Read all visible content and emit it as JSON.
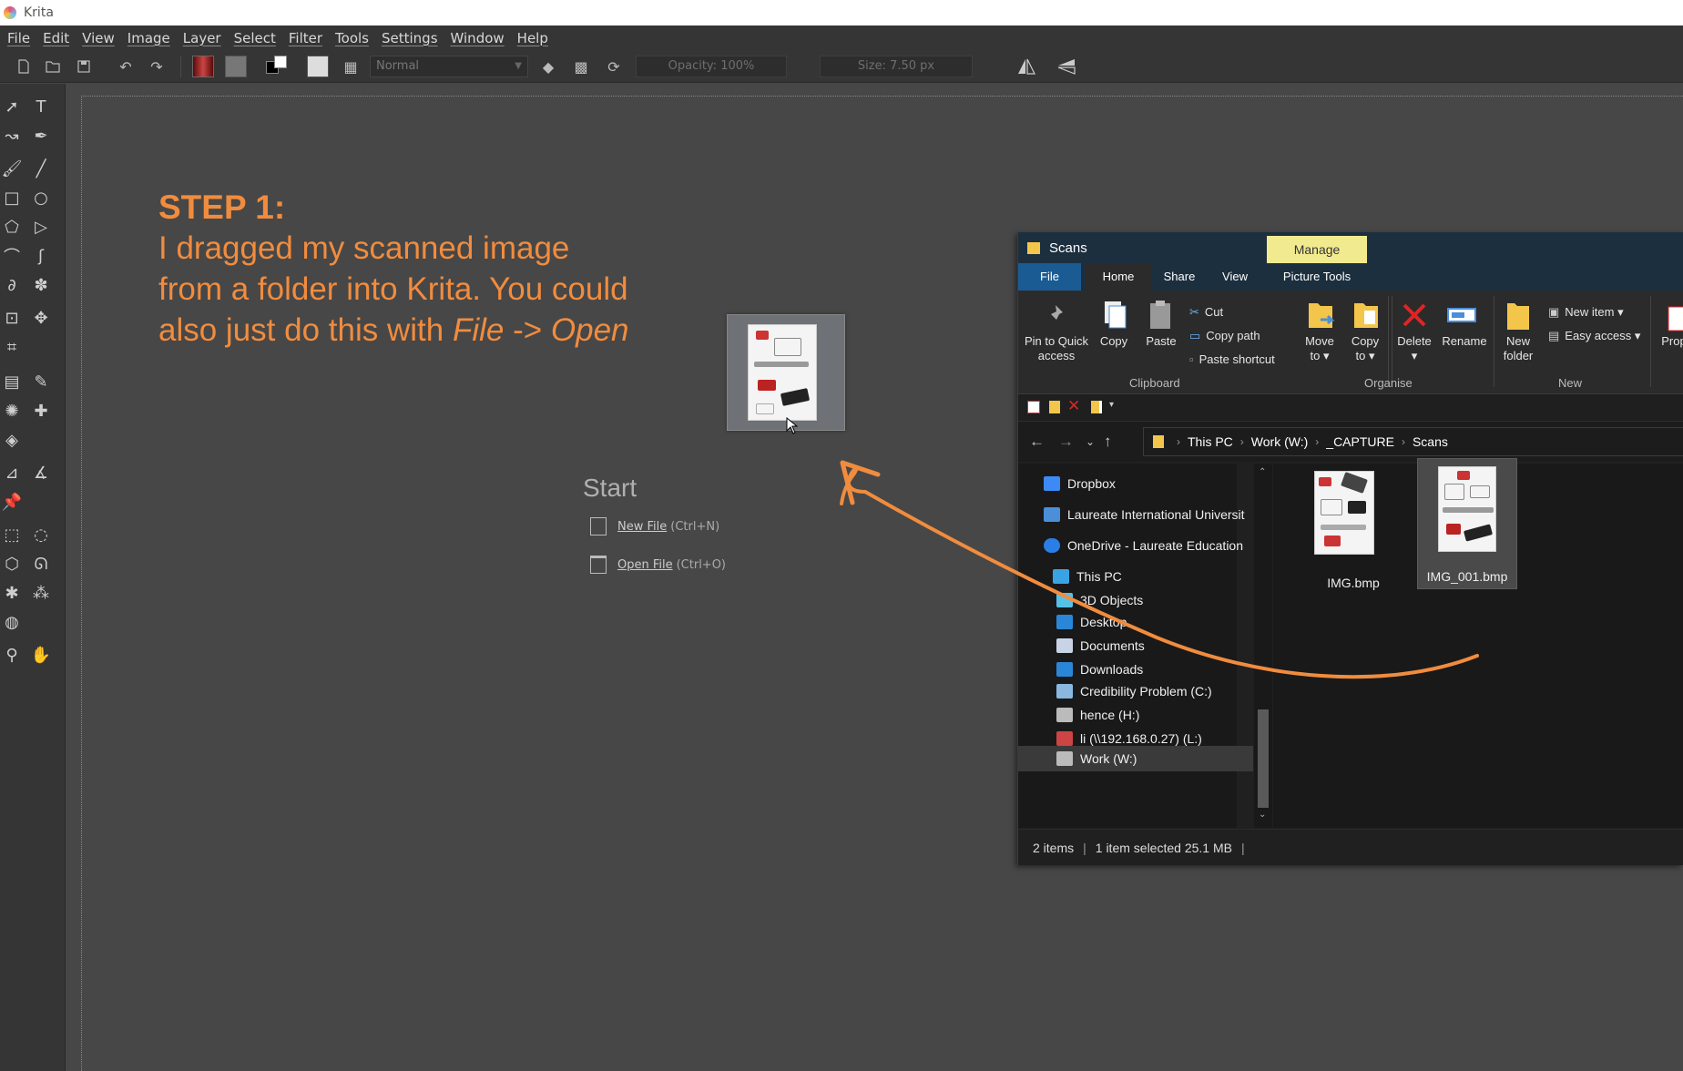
{
  "app": {
    "title": "Krita"
  },
  "menubar": {
    "items": [
      "File",
      "Edit",
      "View",
      "Image",
      "Layer",
      "Select",
      "Filter",
      "Tools",
      "Settings",
      "Window",
      "Help"
    ]
  },
  "toolbar": {
    "blend_mode": "Normal",
    "opacity_label": "Opacity:  100%",
    "size_label": "Size:  7.50 px"
  },
  "annotation": {
    "heading": "STEP 1:",
    "line1": "I dragged my scanned image",
    "line2": "from a folder into Krita. You could",
    "line3_prefix": "also just do this with ",
    "line3_file": "File",
    "line3_arrow": " -> ",
    "line3_open": "Open"
  },
  "start": {
    "title": "Start",
    "new_file_label": "New File",
    "new_file_shortcut": "(Ctrl+N)",
    "open_file_label": "Open File",
    "open_file_shortcut": "(Ctrl+O)"
  },
  "explorer": {
    "title": "Scans",
    "manage_tab": "Manage",
    "tabs": {
      "file": "File",
      "home": "Home",
      "share": "Share",
      "view": "View",
      "picture_tools": "Picture Tools"
    },
    "ribbon": {
      "pin_line1": "Pin to Quick",
      "pin_line2": "access",
      "copy": "Copy",
      "paste": "Paste",
      "cut": "Cut",
      "copy_path": "Copy path",
      "paste_shortcut": "Paste shortcut",
      "clipboard_group": "Clipboard",
      "move_line1": "Move",
      "move_line2": "to ▾",
      "copyto_line1": "Copy",
      "copyto_line2": "to ▾",
      "delete": "Delete",
      "delete_arrow": "▾",
      "rename": "Rename",
      "organise_group": "Organise",
      "new_folder_line1": "New",
      "new_folder_line2": "folder",
      "new_item": "New item ▾",
      "easy_access": "Easy access ▾",
      "new_group": "New",
      "properties": "Prop"
    },
    "address": {
      "this_pc": "This PC",
      "work": "Work (W:)",
      "capture": "_CAPTURE",
      "scans": "Scans"
    },
    "tree": {
      "dropbox": "Dropbox",
      "laureate": "Laureate International Universit",
      "onedrive": "OneDrive - Laureate Education",
      "this_pc": "This PC",
      "objects3d": "3D Objects",
      "desktop": "Desktop",
      "documents": "Documents",
      "downloads": "Downloads",
      "credibility": "Credibility Problem (C:)",
      "hence": "hence (H:)",
      "li": "li (\\\\192.168.0.27) (L:)",
      "work": "Work (W:)"
    },
    "files": [
      {
        "name": "IMG.bmp",
        "selected": false
      },
      {
        "name": "IMG_001.bmp",
        "selected": true
      }
    ],
    "status": {
      "items": "2 items",
      "selected": "1 item selected  25.1 MB"
    }
  },
  "colors": {
    "accent_orange": "#f18c3e",
    "manage_yellow": "#f2ea8f",
    "explorer_title": "#1c2f3f"
  }
}
